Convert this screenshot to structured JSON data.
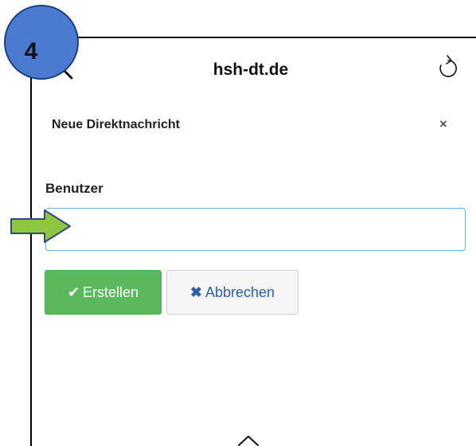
{
  "tutorial": {
    "step": "4"
  },
  "browser": {
    "site_title": "hsh-dt.de"
  },
  "dialog": {
    "title": "Neue Direktnachricht",
    "close_symbol": "×",
    "field": {
      "label": "Benutzer",
      "value": "",
      "placeholder": ""
    },
    "buttons": {
      "create": {
        "label": "Erstellen",
        "icon": "check-icon"
      },
      "cancel": {
        "label": "Abbrechen",
        "icon": "x-icon"
      }
    }
  },
  "colors": {
    "badge": "#4a7bd0",
    "create_button": "#5cb85c",
    "cancel_text": "#2a5fa8",
    "arrow": "#8dc63f",
    "input_focus_border": "#66afe9"
  }
}
